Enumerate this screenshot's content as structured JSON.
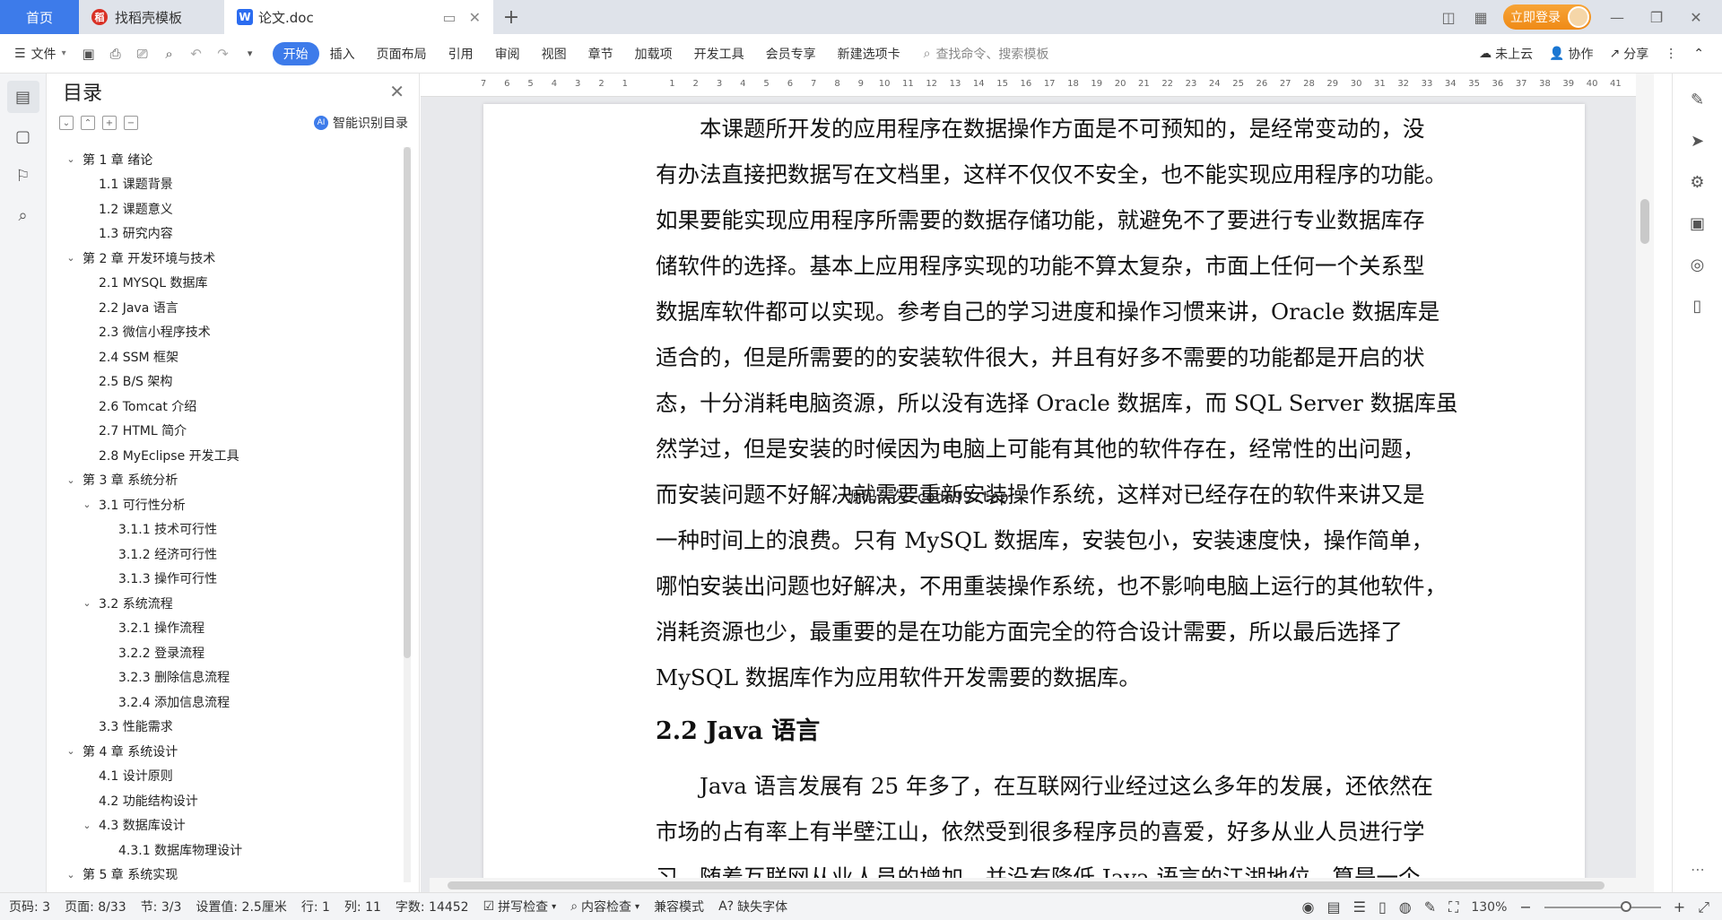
{
  "tabs": {
    "home": "首页",
    "template": "找稻壳模板",
    "doc": "论文.doc"
  },
  "titlebar": {
    "login": "立即登录"
  },
  "ribbon": {
    "file": "文件",
    "tabs": [
      "开始",
      "插入",
      "页面布局",
      "引用",
      "审阅",
      "视图",
      "章节",
      "加载项",
      "开发工具",
      "会员专享",
      "新建选项卡"
    ],
    "search_placeholder": "查找命令、搜索模板",
    "cloud": "未上云",
    "collab": "协作",
    "share": "分享"
  },
  "toc": {
    "title": "目录",
    "smart": "智能识别目录",
    "items": [
      {
        "level": 1,
        "expanded": true,
        "text": "第 1 章  绪论"
      },
      {
        "level": 2,
        "text": "1.1  课题背景"
      },
      {
        "level": 2,
        "text": "1.2  课题意义"
      },
      {
        "level": 2,
        "text": "1.3  研究内容"
      },
      {
        "level": 1,
        "expanded": true,
        "text": "第 2 章  开发环境与技术"
      },
      {
        "level": 2,
        "text": "2.1  MYSQL 数据库"
      },
      {
        "level": 2,
        "text": "2.2 Java 语言"
      },
      {
        "level": 2,
        "text": "2.3  微信小程序技术"
      },
      {
        "level": 2,
        "text": "2.4 SSM 框架"
      },
      {
        "level": 2,
        "text": "2.5 B/S 架构"
      },
      {
        "level": 2,
        "text": "2.6 Tomcat  介绍"
      },
      {
        "level": 2,
        "text": "2.7 HTML 简介"
      },
      {
        "level": 2,
        "text": "2.8 MyEclipse 开发工具"
      },
      {
        "level": 1,
        "expanded": true,
        "text": "第 3 章  系统分析"
      },
      {
        "level": 2,
        "expanded": true,
        "caret": true,
        "text": "3.1  可行性分析"
      },
      {
        "level": 3,
        "text": "3.1.1  技术可行性"
      },
      {
        "level": 3,
        "text": "3.1.2  经济可行性"
      },
      {
        "level": 3,
        "text": "3.1.3  操作可行性"
      },
      {
        "level": 2,
        "expanded": true,
        "caret": true,
        "text": "3.2  系统流程"
      },
      {
        "level": 3,
        "text": "3.2.1  操作流程"
      },
      {
        "level": 3,
        "text": "3.2.2  登录流程"
      },
      {
        "level": 3,
        "text": "3.2.3  删除信息流程"
      },
      {
        "level": 3,
        "text": "3.2.4  添加信息流程"
      },
      {
        "level": 2,
        "text": "3.3  性能需求"
      },
      {
        "level": 1,
        "expanded": true,
        "text": "第 4 章  系统设计"
      },
      {
        "level": 2,
        "text": "4.1  设计原则"
      },
      {
        "level": 2,
        "text": "4.2  功能结构设计"
      },
      {
        "level": 2,
        "expanded": true,
        "caret": true,
        "text": "4.3  数据库设计"
      },
      {
        "level": 3,
        "text": "4.3.1  数据库物理设计"
      },
      {
        "level": 1,
        "expanded": true,
        "text": "第 5 章  系统实现"
      }
    ]
  },
  "ruler": [
    "7",
    "6",
    "5",
    "4",
    "3",
    "2",
    "1",
    "",
    "1",
    "2",
    "3",
    "4",
    "5",
    "6",
    "7",
    "8",
    "9",
    "10",
    "11",
    "12",
    "13",
    "14",
    "15",
    "16",
    "17",
    "18",
    "19",
    "20",
    "21",
    "22",
    "23",
    "24",
    "25",
    "26",
    "27",
    "28",
    "29",
    "30",
    "31",
    "32",
    "33",
    "34",
    "35",
    "36",
    "37",
    "38",
    "39",
    "40",
    "41"
  ],
  "document": {
    "para1_lines": [
      "本课题所开发的应用程序在数据操作方面是不可预知的，是经常变动的，没",
      "有办法直接把数据写在文档里，这样不仅仅不安全，也不能实现应用程序的功能。",
      "如果要能实现应用程序所需要的数据存储功能，就避免不了要进行专业数据库存",
      "储软件的选择。基本上应用程序实现的功能不算太复杂，市面上任何一个关系型",
      "数据库软件都可以实现。参考自己的学习进度和操作习惯来讲，Oracle 数据库是",
      "适合的，但是所需要的的安装软件很大，并且有好多不需要的功能都是开启的状",
      "态，十分消耗电脑资源，所以没有选择 Oracle 数据库，而 SQL Server 数据库虽",
      "然学过，但是安装的时候因为电脑上可能有其他的软件存在，经常性的出问题，",
      "而安装问题不好解决就需要重新安装操作系统，这样对已经存在的软件来讲又是",
      "一种时间上的浪费。只有 MySQL 数据库，安装包小，安装速度快，操作简单，",
      "哪怕安装出问题也好解决，不用重装操作系统，也不影响电脑上运行的其他软件，",
      "消耗资源也少，最重要的是在功能方面完全的符合设计需要，所以最后选择了",
      "MySQL 数据库作为应用软件开发需要的数据库。"
    ],
    "heading": "2.2 Java 语言",
    "para2_lines": [
      "Java 语言发展有 25 年多了，在互联网行业经过这么多年的发展，还依然在",
      "市场的占有率上有半壁江山，依然受到很多程序员的喜爱，好多从业人员进行学",
      "习，随着互联网从业人员的增加，并没有降低 Java 语言的江湖地位，算是一个"
    ],
    "watermark": "源码久久-code99.top"
  },
  "statusbar": {
    "page_no": "页码: 3",
    "pages": "页面: 8/33",
    "section": "节: 3/3",
    "setting": "设置值: 2.5厘米",
    "row": "行: 1",
    "col": "列: 11",
    "words": "字数: 14452",
    "spell": "拼写检查",
    "content_check": "内容检查",
    "compat": "兼容模式",
    "missing_font": "缺失字体",
    "zoom": "130%",
    "zoom_level": 0.72
  }
}
